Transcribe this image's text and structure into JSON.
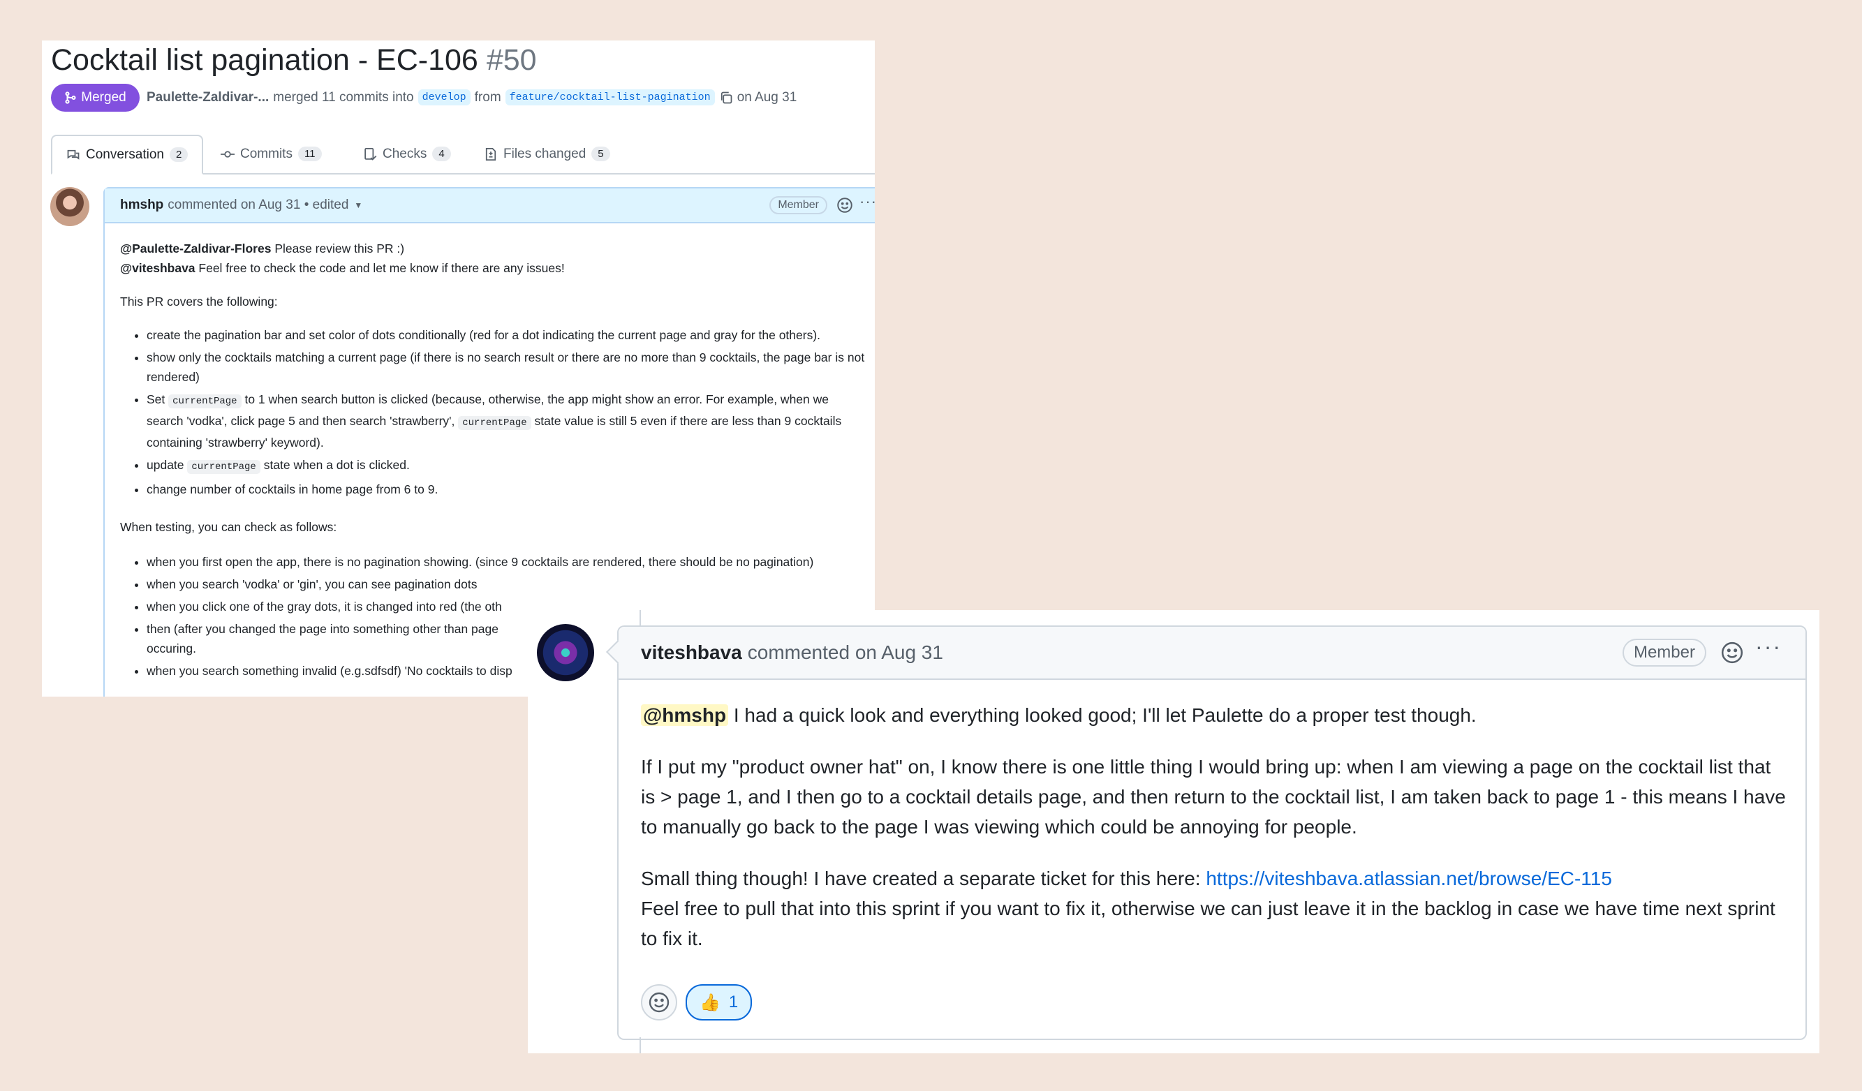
{
  "pr": {
    "title": "Cocktail list pagination - EC-106",
    "number": "#50",
    "status": "Merged",
    "author": "Paulette-Zaldivar-...",
    "merged_text": "merged 11 commits into",
    "base_branch": "develop",
    "from_text": "from",
    "head_branch": "feature/cocktail-list-pagination",
    "date_text": "on Aug 31",
    "accent_color": "#8250df"
  },
  "tabs": [
    {
      "label": "Conversation",
      "count": "2",
      "icon": "comment-discussion-icon"
    },
    {
      "label": "Commits",
      "count": "11",
      "icon": "git-commit-icon"
    },
    {
      "label": "Checks",
      "count": "4",
      "icon": "checklist-icon"
    },
    {
      "label": "Files changed",
      "count": "5",
      "icon": "file-diff-icon"
    }
  ],
  "comment1": {
    "author": "hmshp",
    "meta": "commented on Aug 31 • edited",
    "badge": "Member",
    "line1_mention": "@Paulette-Zaldivar-Flores",
    "line1_text": "Please review this PR :)",
    "line2_mention": "@viteshbava",
    "line2_text": "Feel free to check the code and let me know if there are any issues!",
    "covers_heading": "This PR covers the following:",
    "covers": {
      "i1": "create the pagination bar and set color of dots conditionally (red for a dot indicating the current page and gray for the others).",
      "i2": "show only the cocktails matching a current page (if there is no search result or there are no more than 9 cocktails, the page bar is not rendered)",
      "i3_a": "Set",
      "i3_code1": "currentPage",
      "i3_b": "to 1 when search button is clicked (because, otherwise, the app might show an error. For example, when we search 'vodka', click page 5 and then search 'strawberry',",
      "i3_code2": "currentPage",
      "i3_c": "state value is still 5 even if there are less than 9 cocktails containing 'strawberry' keyword).",
      "i4_a": "update",
      "i4_code": "currentPage",
      "i4_b": "state when a dot is clicked.",
      "i5": "change number of cocktails in home page from 6 to 9."
    },
    "testing_heading": "When testing, you can check as follows:",
    "testing": {
      "t1": "when you first open the app, there is no pagination showing. (since 9 cocktails are rendered, there should be no pagination)",
      "t2": "when you search 'vodka' or 'gin', you can see pagination dots",
      "t3": "when you click one of the gray dots, it is changed into red (the oth",
      "t4": "then (after you changed the page into something other than page occuring.",
      "t5": "when you search something invalid (e.g.sdfsdf) 'No cocktails to disp"
    }
  },
  "comment2": {
    "author": "viteshbava",
    "meta": "commented on Aug 31",
    "badge": "Member",
    "p1_mention": "@hmshp",
    "p1_text": "I had a quick look and everything looked good; I'll let Paulette do a proper test though.",
    "p2": "If I put my \"product owner hat\" on, I know there is one little thing I would bring up: when I am viewing a page on the cocktail list that is > page 1, and I then go to a cocktail details page, and then return to the cocktail list, I am taken back to page 1 - this means I have to manually go back to the page I was viewing which could be annoying for people.",
    "p3_text": "Small thing though! I have created a separate ticket for this here:",
    "p3_link": "https://viteshbava.atlassian.net/browse/EC-115",
    "p4": "Feel free to pull that into this sprint if you want to fix it, otherwise we can just leave it in the backlog in case we have time next sprint to fix it.",
    "reaction_emoji": "👍",
    "reaction_count": "1"
  }
}
